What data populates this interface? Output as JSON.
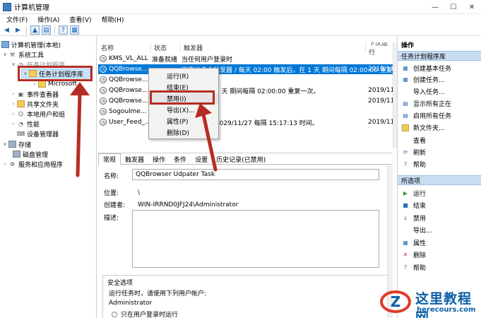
{
  "window": {
    "title": "计算机管理",
    "buttons": {
      "minimize": "—",
      "maximize": "☐",
      "close": "✕"
    }
  },
  "menu": [
    "文件(F)",
    "操作(A)",
    "查看(V)",
    "帮助(H)"
  ],
  "tree": {
    "root": "计算机管理(本地)",
    "system_tools": "系统工具",
    "task_scheduler": "任务计划程序",
    "task_library": "任务计划程序库",
    "microsoft": "Microsoft",
    "event_viewer": "事件查看器",
    "shared_folders": "共享文件夹",
    "local_users": "本地用户和组",
    "performance": "性能",
    "device_manager": "设备管理器",
    "storage": "存储",
    "disk_management": "磁盘管理",
    "services": "服务和应用程序"
  },
  "tasks": {
    "headers": {
      "name": "名称",
      "status": "状态",
      "trigger": "触发器",
      "next": "下次运行"
    },
    "rows": [
      {
        "name": "KMS_VL_ALL",
        "status": "准备就绪",
        "trigger": "当任何用户登录时",
        "next": ""
      },
      {
        "name": "QQBrowse...",
        "status": "",
        "trigger": "已定义多个触发器 / 每天 02:00 触发后，在 1 天 期间每隔 02:00:00 重复一次。",
        "next": "2019/11"
      },
      {
        "name": "QQBrowse...",
        "status": "",
        "trigger": "",
        "next": ""
      },
      {
        "name": "QQBrowse...",
        "status": "",
        "trigger": "触发后，在 1 天 期间每隔 02:00:00 重复一次。",
        "next": "2019/11"
      },
      {
        "name": "QQBrowse...",
        "status": "",
        "trigger": "",
        "next": "2019/11"
      },
      {
        "name": "Sogoulme...",
        "status": "",
        "trigger": "",
        "next": ""
      },
      {
        "name": "User_Feed_...",
        "status": "",
        "trigger": "触发后，在 2029/11/27 每隔 15:17:13 时间。",
        "next": "2019/11"
      }
    ]
  },
  "context_menu": {
    "run": "运行(R)",
    "end": "结束(E)",
    "disable": "禁用(I)",
    "export": "导出(X)...",
    "properties": "属性(P)",
    "delete": "删除(D)"
  },
  "detail": {
    "tabs": [
      "常规",
      "触发器",
      "操作",
      "条件",
      "设置",
      "历史记录(已禁用)"
    ],
    "name_label": "名称:",
    "name_value": "QQBrowser Udpater Task",
    "location_label": "位置:",
    "location_value": "\\",
    "author_label": "创建者:",
    "author_value": "WIN-IRRND0JFJ24\\Administrator",
    "desc_label": "描述:",
    "security_title": "安全选项",
    "security_run_as": "运行任务时，请使用下列用户帐户:",
    "security_user": "Administrator",
    "security_option": "只在用户登录时运行"
  },
  "actions": {
    "header": "操作",
    "section1": "任务计划程序库",
    "items1": [
      "创建基本任务",
      "创建任务...",
      "导入任务...",
      "显示所有正在",
      "启用所有任务",
      "新文件夹...",
      "查看",
      "刷新",
      "帮助"
    ],
    "section2": "所选项",
    "items2": [
      "运行",
      "结束",
      "禁用",
      "导出...",
      "属性",
      "删除",
      "帮助"
    ]
  },
  "watermark": {
    "title": "这里教程网",
    "url": "herecours.com"
  },
  "colors": {
    "highlight": "#b52c24",
    "selection": "#0078d7",
    "section_bg": "#c9ddf2",
    "watermark": "#0b5fa5"
  }
}
